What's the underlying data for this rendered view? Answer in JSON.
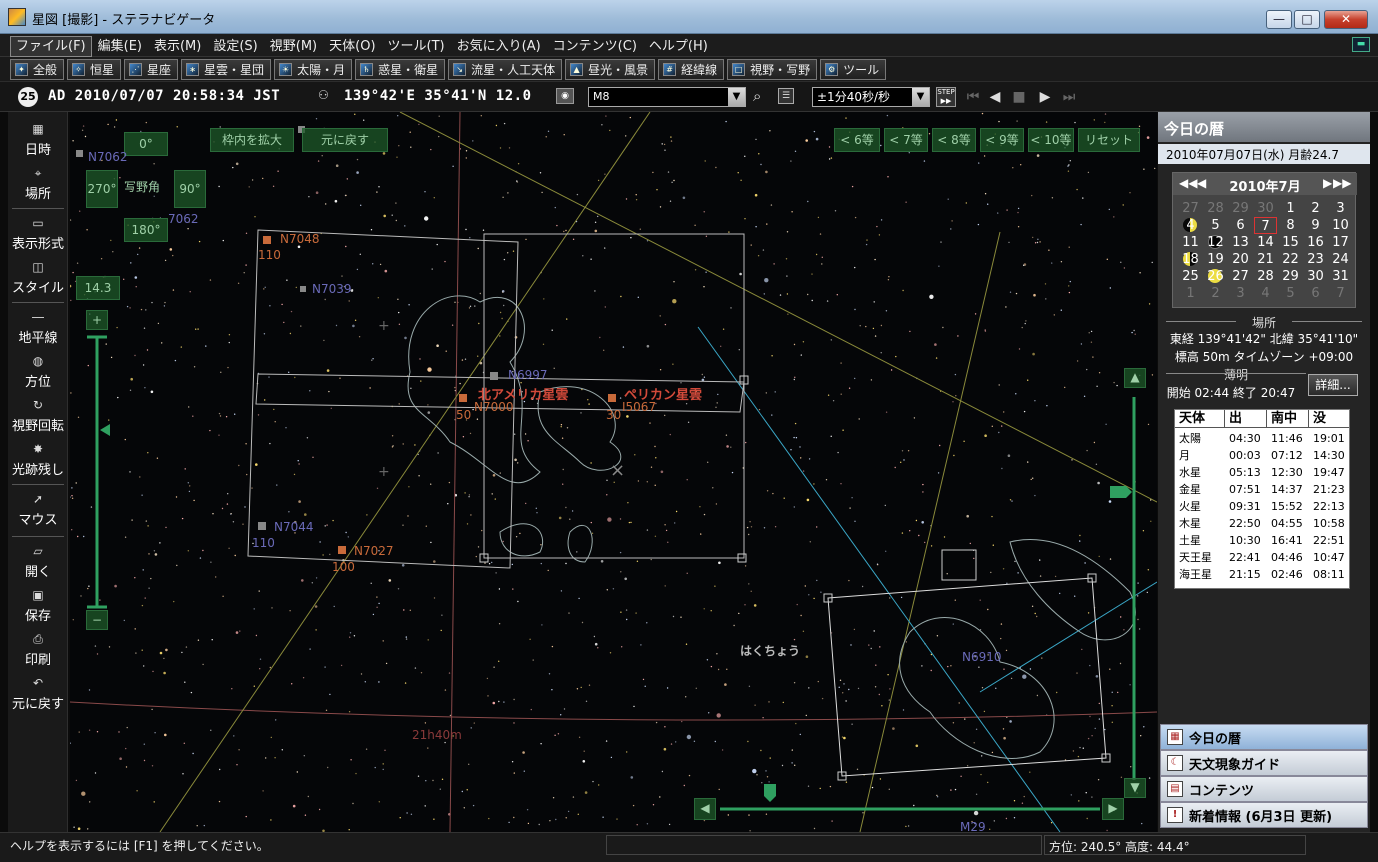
{
  "window": {
    "title": "星図 [撮影] - ステラナビゲータ",
    "min": "—",
    "max": "□",
    "close": "✕"
  },
  "menu": [
    "ファイル(F)",
    "編集(E)",
    "表示(M)",
    "設定(S)",
    "視野(M)",
    "天体(O)",
    "ツール(T)",
    "お気に入り(A)",
    "コンテンツ(C)",
    "ヘルプ(H)"
  ],
  "toolbar1": [
    {
      "label": "全般",
      "icon": "general-icon"
    },
    {
      "label": "恒星",
      "icon": "star-icon"
    },
    {
      "label": "星座",
      "icon": "constellation-icon"
    },
    {
      "label": "星雲・星団",
      "icon": "nebula-icon"
    },
    {
      "label": "太陽・月",
      "icon": "sun-moon-icon"
    },
    {
      "label": "惑星・衛星",
      "icon": "planet-icon"
    },
    {
      "label": "流星・人工天体",
      "icon": "meteor-icon"
    },
    {
      "label": "昼光・風景",
      "icon": "landscape-icon"
    },
    {
      "label": "経緯線",
      "icon": "gridline-icon"
    },
    {
      "label": "視野・写野",
      "icon": "field-of-view-icon"
    },
    {
      "label": "ツール",
      "icon": "tool-icon"
    }
  ],
  "toolbar2": {
    "era": "25",
    "datetime": "AD 2010/07/07 20:58:34 JST",
    "location": "139°42'E 35°41'N 12.0",
    "search_value": "M8",
    "speed_value": "±1分40秒/秒",
    "step_label": "STEP"
  },
  "left_toolbar": [
    {
      "label": "日時",
      "icon": "calendar-icon"
    },
    {
      "label": "場所",
      "icon": "location-icon"
    },
    {
      "label": "表示形式",
      "icon": "display-format-icon"
    },
    {
      "label": "スタイル",
      "icon": "style-icon"
    },
    {
      "label": "地平線",
      "icon": "horizon-icon"
    },
    {
      "label": "方位",
      "icon": "compass-icon"
    },
    {
      "label": "視野回転",
      "icon": "rotate-view-icon"
    },
    {
      "label": "光跡残し",
      "icon": "trail-icon"
    },
    {
      "label": "マウス",
      "icon": "mouse-icon"
    },
    {
      "label": "開く",
      "icon": "open-icon"
    },
    {
      "label": "保存",
      "icon": "save-icon"
    },
    {
      "label": "印刷",
      "icon": "print-icon"
    },
    {
      "label": "元に戻す",
      "icon": "undo-icon"
    }
  ],
  "sky": {
    "compass": {
      "n": "0°",
      "w": "270°",
      "e": "90°",
      "s": "180°",
      "title": "写野角"
    },
    "fov_value": "14.3",
    "zoom_plus": "+",
    "zoom_minus": "−",
    "buttons": {
      "enlarge": "枠内を拡大",
      "restore": "元に戻す"
    },
    "mag_buttons": [
      "< 6等",
      "< 7等",
      "< 8等",
      "< 9等",
      "< 10等",
      "リセット"
    ],
    "labels": {
      "n7062_top": "N7062",
      "n7062": "7062",
      "n7048": "N7048",
      "n7048_mag": "110",
      "n7039": "N7039",
      "n6997": "N6997",
      "n7000": "N7000",
      "n5067": "I5067",
      "n_america": "北アメリカ星雲",
      "pelican": "ペリカン星雲",
      "mag50": "50",
      "mag30": "30",
      "n7044": "N7044",
      "n7044_mag": "110",
      "n7027": "N7027",
      "n7027_mag": "100",
      "cygnus": "はくちょう",
      "n6910": "N6910",
      "ra21": "21h40m",
      "bottom_m": "M29"
    }
  },
  "right_panel": {
    "header": "今日の暦",
    "date_line": "2010年07月07日(水) 月齢24.7",
    "calendar": {
      "title": "2010年7月",
      "nav_prev_year": "◀◀",
      "nav_prev": "◀",
      "nav_next": "▶",
      "nav_next_year": "▶▶",
      "weeks": [
        [
          "27",
          "28",
          "29",
          "30",
          "1",
          "2",
          "3"
        ],
        [
          "4",
          "5",
          "6",
          "7",
          "8",
          "9",
          "10"
        ],
        [
          "11",
          "12",
          "13",
          "14",
          "15",
          "16",
          "17"
        ],
        [
          "18",
          "19",
          "20",
          "21",
          "22",
          "23",
          "24"
        ],
        [
          "25",
          "26",
          "27",
          "28",
          "29",
          "30",
          "31"
        ],
        [
          "1",
          "2",
          "3",
          "4",
          "5",
          "6",
          "7"
        ]
      ]
    },
    "place_title": "場所",
    "place_line1": "東経 139°41'42\" 北緯 35°41'10\"",
    "place_line2": "標高 50m タイムゾーン +09:00",
    "twilight_title": "薄明",
    "twilight_line": "開始 02:44 終了 20:47",
    "detail_button": "詳細...",
    "table_headers": [
      "天体",
      "出",
      "南中",
      "没"
    ],
    "table_rows": [
      [
        "太陽",
        "04:30",
        "11:46",
        "19:01"
      ],
      [
        "月",
        "00:03",
        "07:12",
        "14:30"
      ],
      [
        "水星",
        "05:13",
        "12:30",
        "19:47"
      ],
      [
        "金星",
        "07:51",
        "14:37",
        "21:23"
      ],
      [
        "火星",
        "09:31",
        "15:52",
        "22:13"
      ],
      [
        "木星",
        "22:50",
        "04:55",
        "10:58"
      ],
      [
        "土星",
        "10:30",
        "16:41",
        "22:51"
      ],
      [
        "天王星",
        "22:41",
        "04:46",
        "10:47"
      ],
      [
        "海王星",
        "21:15",
        "02:46",
        "08:11"
      ]
    ],
    "tabs": [
      "今日の暦",
      "天文現象ガイド",
      "コンテンツ",
      "新着情報 (6月3日 更新)"
    ]
  },
  "status": {
    "help": "ヘルプを表示するには [F1] を押してください。",
    "position": "方位: 240.5° 高度: 44.4°"
  }
}
